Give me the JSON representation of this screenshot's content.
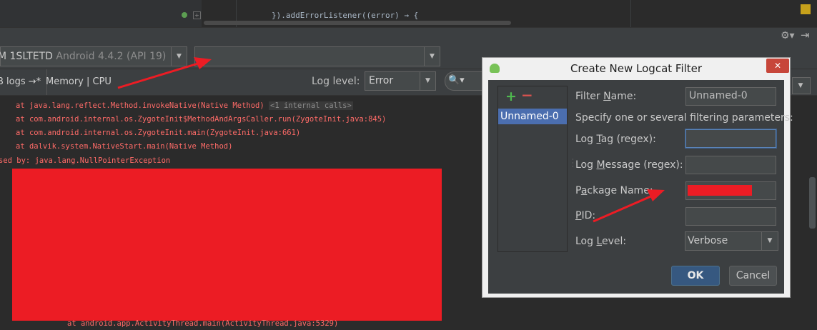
{
  "editor": {
    "code_line": "}).addErrorListener((error) → {"
  },
  "device_bar": {
    "device_name": "M 1SLTETD",
    "device_api": "Android 4.4.2 (API 19)",
    "process_value": ""
  },
  "toolbar": {
    "logcat_tab": "B logs →*",
    "memory_cpu_tab": "Memory | CPU",
    "log_level_label": "Log level:",
    "log_level_value": "Error"
  },
  "log": {
    "lines": [
      "at java.lang.reflect.Method.invokeNative(Native Method)",
      "at com.android.internal.os.ZygoteInit$MethodAndArgsCaller.run(ZygoteInit.java:845)",
      "at com.android.internal.os.ZygoteInit.main(ZygoteInit.java:661)",
      "at dalvik.system.NativeStart.main(Native Method)",
      "sed by: java.lang.NullPointerException",
      "at android.app.ActivityThread.main(ActivityThread.java:5329)"
    ],
    "internal_calls": "<1 internal calls>"
  },
  "dialog": {
    "title": "Create New Logcat Filter",
    "close_label": "✕",
    "add_label": "+",
    "remove_label": "−",
    "filter_item": "Unnamed-0",
    "filter_name_label_pre": "Filter ",
    "filter_name_label_u": "N",
    "filter_name_label_post": "ame:",
    "filter_name_value": "Unnamed-0",
    "specify_text": "Specify one or several filtering parameters:",
    "log_tag_label_pre": "Log ",
    "log_tag_label_u": "T",
    "log_tag_label_post": "ag (regex):",
    "log_tag_value": "",
    "log_message_label_pre": "Log ",
    "log_message_label_u": "M",
    "log_message_label_post": "essage (regex):",
    "log_message_value": "",
    "package_label_pre": "P",
    "package_label_u": "a",
    "package_label_post": "ckage Name:",
    "pid_label_u": "P",
    "pid_label_post": "ID:",
    "pid_value": "",
    "log_level_label_pre": "Log ",
    "log_level_label_u": "L",
    "log_level_label_post": "evel:",
    "log_level_value": "Verbose",
    "ok_label": "OK",
    "cancel_label": "Cancel"
  },
  "colors": {
    "log_error": "#ff6b68",
    "redaction": "#ec1c24",
    "annotation_arrow": "#ec1c24"
  }
}
